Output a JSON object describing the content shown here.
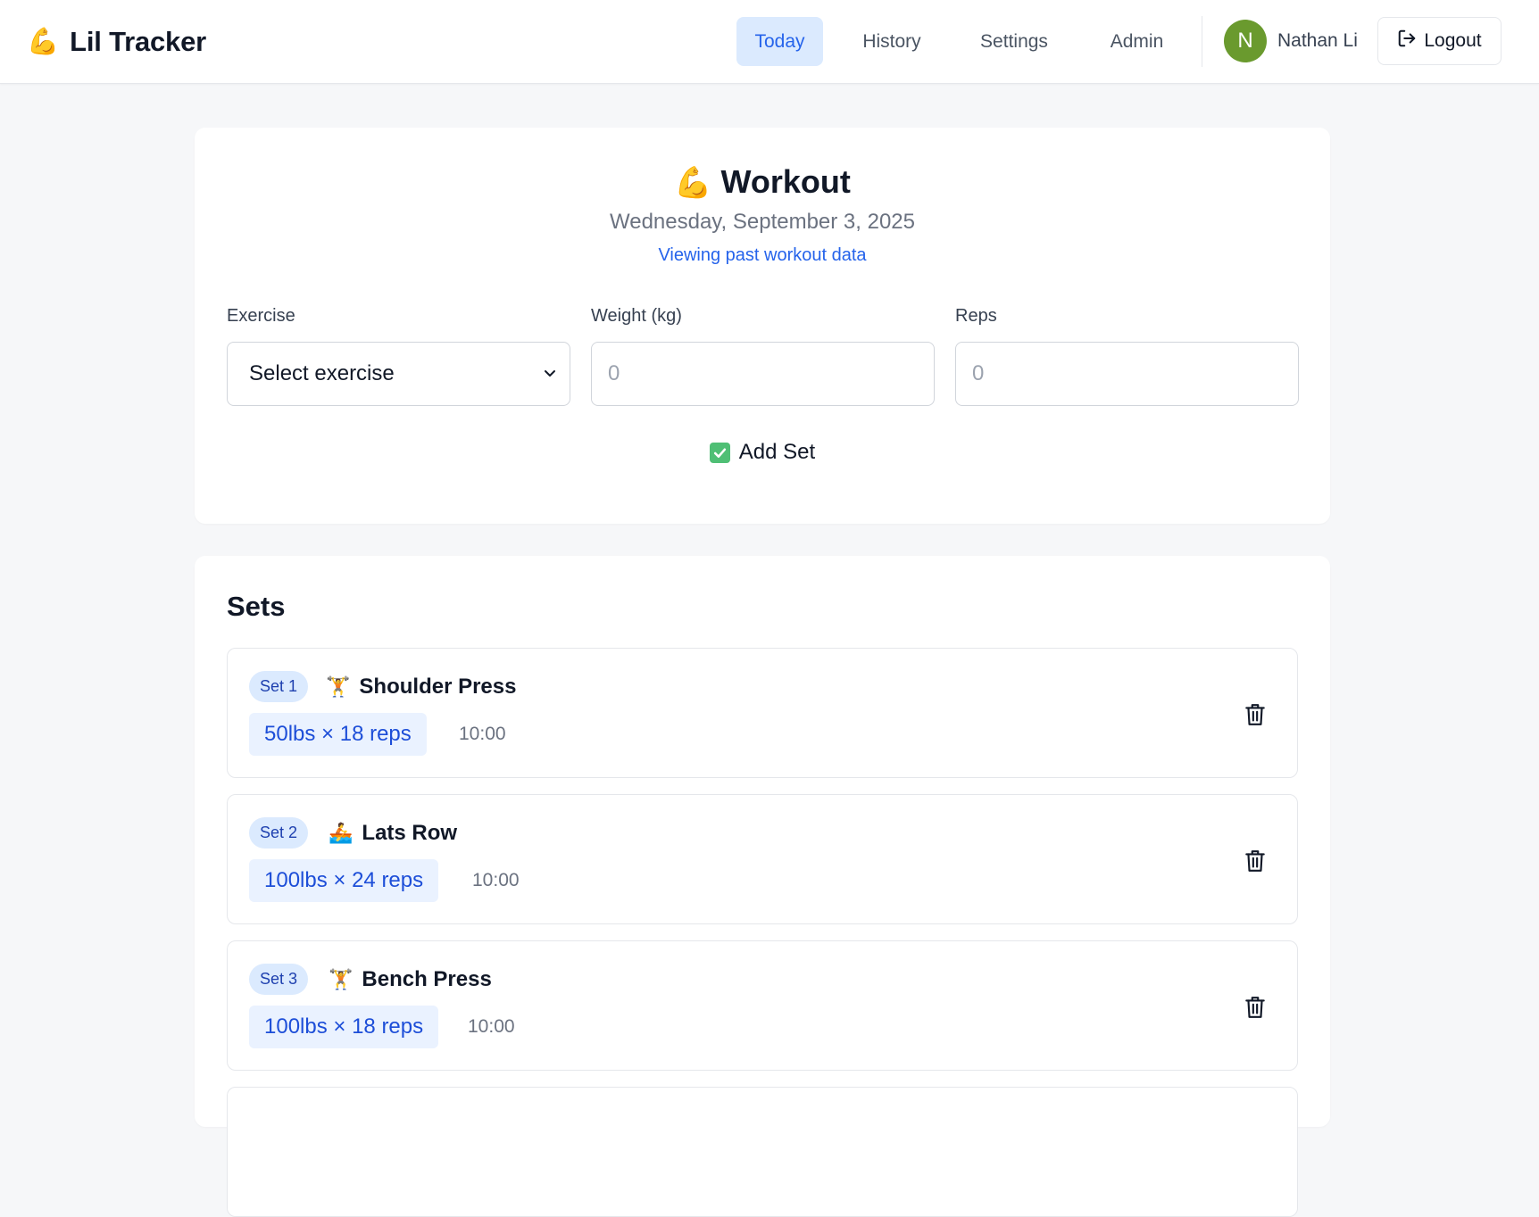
{
  "app": {
    "logo_emoji": "💪",
    "title": "Lil Tracker"
  },
  "nav": {
    "items": [
      {
        "label": "Today",
        "active": true
      },
      {
        "label": "History",
        "active": false
      },
      {
        "label": "Settings",
        "active": false
      },
      {
        "label": "Admin",
        "active": false
      }
    ]
  },
  "user": {
    "initial": "N",
    "name": "Nathan Li",
    "avatar_color": "#6a9a2e",
    "logout_label": "Logout"
  },
  "workout": {
    "emoji": "💪",
    "title": "Workout",
    "date": "Wednesday, September 3, 2025",
    "note": "Viewing past workout data"
  },
  "form": {
    "exercise_label": "Exercise",
    "exercise_value": "Select exercise",
    "weight_label": "Weight (kg)",
    "weight_placeholder": "0",
    "reps_label": "Reps",
    "reps_placeholder": "0",
    "add_set_label": "Add Set"
  },
  "sets": {
    "title": "Sets",
    "items": [
      {
        "badge": "Set 1",
        "emoji": "🏋️",
        "exercise": "Shoulder Press",
        "stats": "50lbs × 18 reps",
        "time": "10:00"
      },
      {
        "badge": "Set 2",
        "emoji": "🚣",
        "exercise": "Lats Row",
        "stats": "100lbs × 24 reps",
        "time": "10:00"
      },
      {
        "badge": "Set 3",
        "emoji": "🏋️",
        "exercise": "Bench Press",
        "stats": "100lbs × 18 reps",
        "time": "10:00"
      }
    ]
  },
  "colors": {
    "accent": "#2563eb",
    "accent_bg": "#dbeafe",
    "success": "#4fbf75"
  }
}
